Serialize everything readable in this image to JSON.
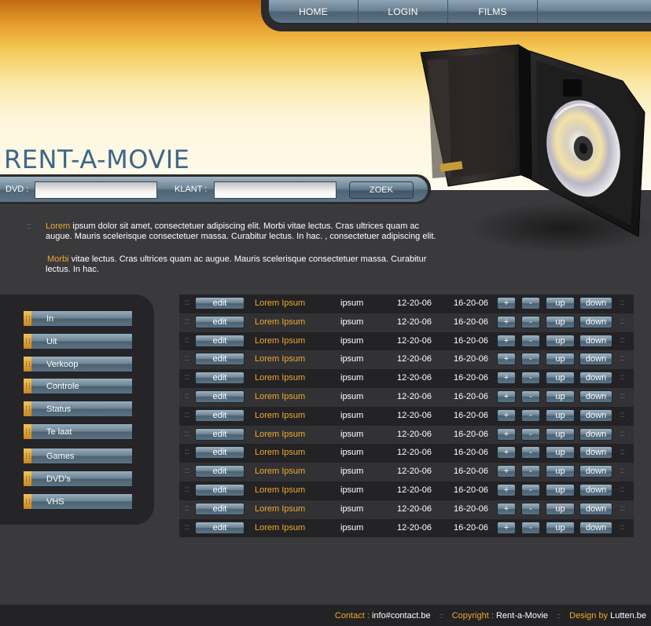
{
  "nav": {
    "items": [
      {
        "label": "HOME"
      },
      {
        "label": "LOGIN"
      },
      {
        "label": "FILMS"
      },
      {
        "label": ""
      }
    ]
  },
  "site": {
    "title": "RENT-A-MOVIE"
  },
  "search": {
    "dvd_label": "DVD :",
    "klant_label": "KLANT :",
    "dvd_value": "",
    "klant_value": "",
    "button_label": "ZOEK"
  },
  "intro": {
    "para1_highlight": "Lorem",
    "para1_text": " ipsum dolor sit amet, consectetuer adipiscing elit. Morbi vitae lectus. Cras ultrices quam ac augue. Mauris scelerisque consectetuer massa. Curabitur lectus. In hac. , consectetuer adipiscing elit.",
    "para2_highlight": "Morbi",
    "para2_text": " vitae lectus. Cras ultrices quam ac augue. Mauris scelerisque consectetuer massa. Curabitur lectus. In hac.",
    "bullet": "::"
  },
  "sidebar": {
    "items": [
      {
        "label": "In"
      },
      {
        "label": "Uit"
      },
      {
        "label": "Verkoop"
      },
      {
        "label": "Controle"
      },
      {
        "label": "Status"
      },
      {
        "label": "Te laat"
      },
      {
        "label": "Games"
      },
      {
        "label": "DVD's"
      },
      {
        "label": "VHS"
      }
    ]
  },
  "table": {
    "labels": {
      "edit": "edit",
      "plus": "+",
      "minus": "-",
      "up": "up",
      "down": "down",
      "dots": "::"
    },
    "rows": [
      {
        "title": "Lorem Ipsum",
        "sub": "ipsum",
        "date1": "12-20-06",
        "date2": "16-20-06"
      },
      {
        "title": "Lorem Ipsum",
        "sub": "ipsum",
        "date1": "12-20-06",
        "date2": "16-20-06"
      },
      {
        "title": "Lorem Ipsum",
        "sub": "ipsum",
        "date1": "12-20-06",
        "date2": "16-20-06"
      },
      {
        "title": "Lorem Ipsum",
        "sub": "ipsum",
        "date1": "12-20-06",
        "date2": "16-20-06"
      },
      {
        "title": "Lorem Ipsum",
        "sub": "ipsum",
        "date1": "12-20-06",
        "date2": "16-20-06"
      },
      {
        "title": "Lorem Ipsum",
        "sub": "ipsum",
        "date1": "12-20-06",
        "date2": "16-20-06"
      },
      {
        "title": "Lorem Ipsum",
        "sub": "ipsum",
        "date1": "12-20-06",
        "date2": "16-20-06"
      },
      {
        "title": "Lorem Ipsum",
        "sub": "ipsum",
        "date1": "12-20-06",
        "date2": "16-20-06"
      },
      {
        "title": "Lorem Ipsum",
        "sub": "ipsum",
        "date1": "12-20-06",
        "date2": "16-20-06"
      },
      {
        "title": "Lorem Ipsum",
        "sub": "ipsum",
        "date1": "12-20-06",
        "date2": "16-20-06"
      },
      {
        "title": "Lorem Ipsum",
        "sub": "ipsum",
        "date1": "12-20-06",
        "date2": "16-20-06"
      },
      {
        "title": "Lorem Ipsum",
        "sub": "ipsum",
        "date1": "12-20-06",
        "date2": "16-20-06"
      },
      {
        "title": "Lorem Ipsum",
        "sub": "ipsum",
        "date1": "12-20-06",
        "date2": "16-20-06"
      }
    ]
  },
  "footer": {
    "contact_label": "Contact :",
    "contact_value": " info#contact.be",
    "copyright_label": "Copyright :",
    "copyright_value": " Rent-a-Movie",
    "design_label": "Design by",
    "design_value": " Lutten.be",
    "sep": "::"
  },
  "colors": {
    "accent": "#f0a82c",
    "title_blue": "#3f6686",
    "background": "#3a3a3c"
  },
  "icons": {
    "dvd_case": "dvd-case-icon",
    "grip": "grip-icon"
  }
}
